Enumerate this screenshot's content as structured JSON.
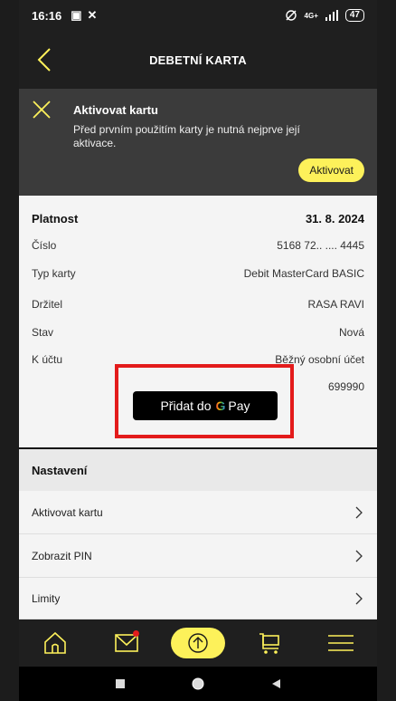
{
  "status_bar": {
    "time": "16:16",
    "battery": "47",
    "signal_text": "4G+"
  },
  "header": {
    "title": "DEBETNÍ KARTA"
  },
  "banner": {
    "title": "Aktivovat kartu",
    "text": "Před prvním použitím karty je nutná nejprve její aktivace.",
    "button_label": "Aktivovat"
  },
  "details": {
    "rows": [
      {
        "label": "Platnost",
        "value": "31. 8. 2024"
      },
      {
        "label": "Číslo",
        "value": "5168 72.. .... 4445"
      },
      {
        "label": "Typ karty",
        "value": "Debit MasterCard BASIC"
      },
      {
        "label": "Držitel",
        "value": "RASA RAVI"
      },
      {
        "label": "Stav",
        "value": "Nová"
      },
      {
        "label": "K účtu",
        "value": "Běžný osobní účet"
      }
    ],
    "account_number": "699990",
    "gpay": {
      "prefix": "Přidat do",
      "g": "G",
      "pay": "Pay"
    }
  },
  "settings": {
    "heading": "Nastavení",
    "items": [
      "Aktivovat kartu",
      "Zobrazit PIN",
      "Limity"
    ]
  },
  "colors": {
    "accent_yellow": "#fdf15a",
    "highlight_red": "#e31b1b",
    "dark": "#1f1f1f"
  }
}
